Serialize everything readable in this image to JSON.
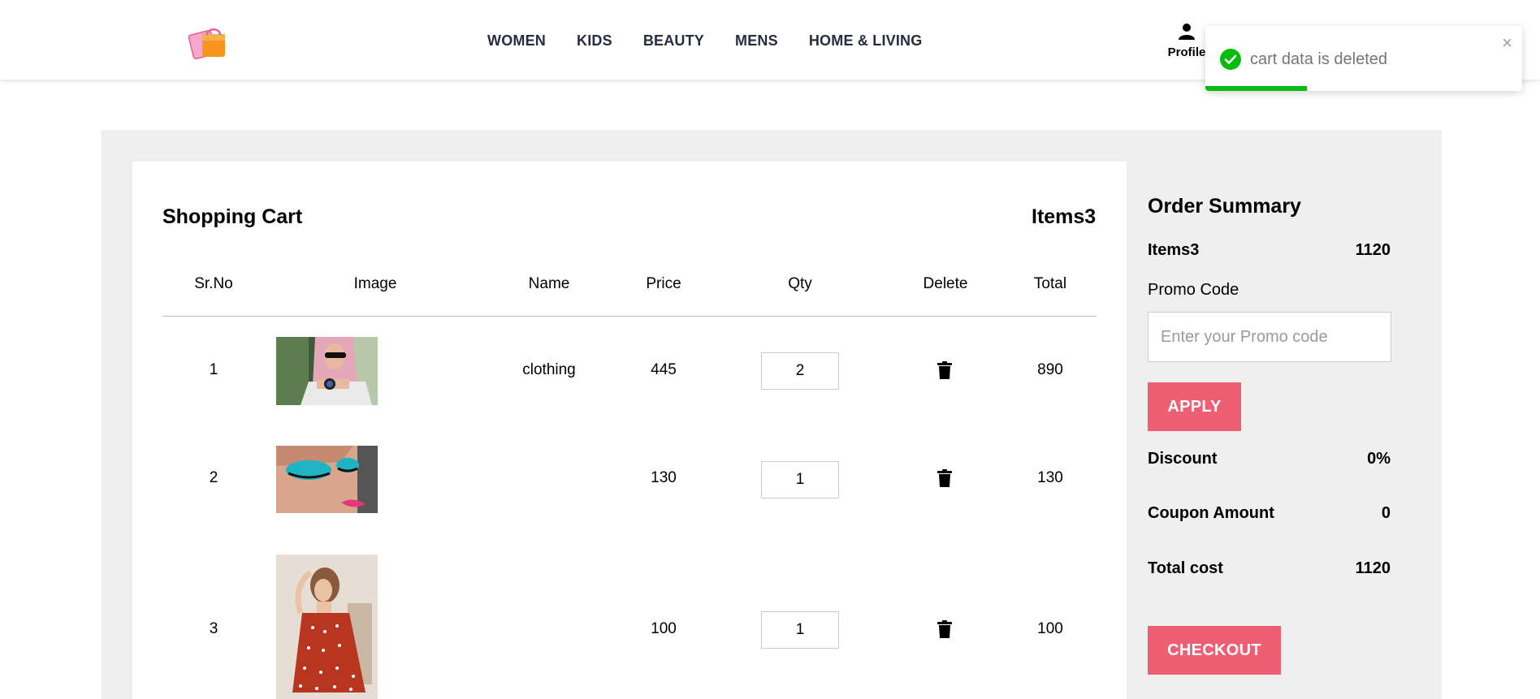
{
  "nav": {
    "items": [
      "WOMEN",
      "KIDS",
      "BEAUTY",
      "MENS",
      "HOME & LIVING"
    ],
    "profile_label": "Profile",
    "profile_icon": "user-icon",
    "logo_icon": "shopping-bag-logo"
  },
  "toast": {
    "message": "cart data is deleted",
    "close": "×",
    "icon": "check-circle-icon",
    "progress_percent": 32,
    "color": "#07bc0c"
  },
  "cart": {
    "title": "Shopping Cart",
    "count_label": "Items3",
    "headers": [
      "Sr.No",
      "Image",
      "Name",
      "Price",
      "Qty",
      "Delete",
      "Total"
    ],
    "rows": [
      {
        "sr": "1",
        "image": "woman-with-watch-photo",
        "name": "clothing",
        "price": "445",
        "qty": "2",
        "total": "890"
      },
      {
        "sr": "2",
        "image": "eye-makeup-photo",
        "name": "",
        "price": "130",
        "qty": "1",
        "total": "130"
      },
      {
        "sr": "3",
        "image": "girl-in-red-polka-dot-dress-photo",
        "name": "",
        "price": "100",
        "qty": "1",
        "total": "100"
      }
    ],
    "delete_icon": "trash-icon"
  },
  "summary": {
    "title": "Order Summary",
    "items_label": "Items3",
    "items_value": "1120",
    "promo_label": "Promo Code",
    "promo_placeholder": "Enter your Promo code",
    "apply_label": "APPLY",
    "discount_label": "Discount",
    "discount_value": "0%",
    "coupon_label": "Coupon Amount",
    "coupon_value": "0",
    "total_label": "Total cost",
    "total_value": "1120",
    "checkout_label": "CHECKOUT"
  },
  "colors": {
    "accent": "#ee5f73",
    "panel_bg": "#efefef",
    "nav_text": "#282c3f"
  }
}
